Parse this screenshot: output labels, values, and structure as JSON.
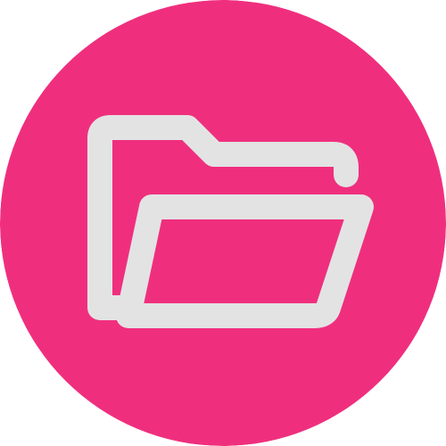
{
  "icon": {
    "name": "open-folder-icon",
    "shape": "circle-badge"
  },
  "colors": {
    "badge_fill": "#EF2F7E",
    "icon_stroke": "#E3E3E3",
    "page_background": "#FFFFFF"
  }
}
